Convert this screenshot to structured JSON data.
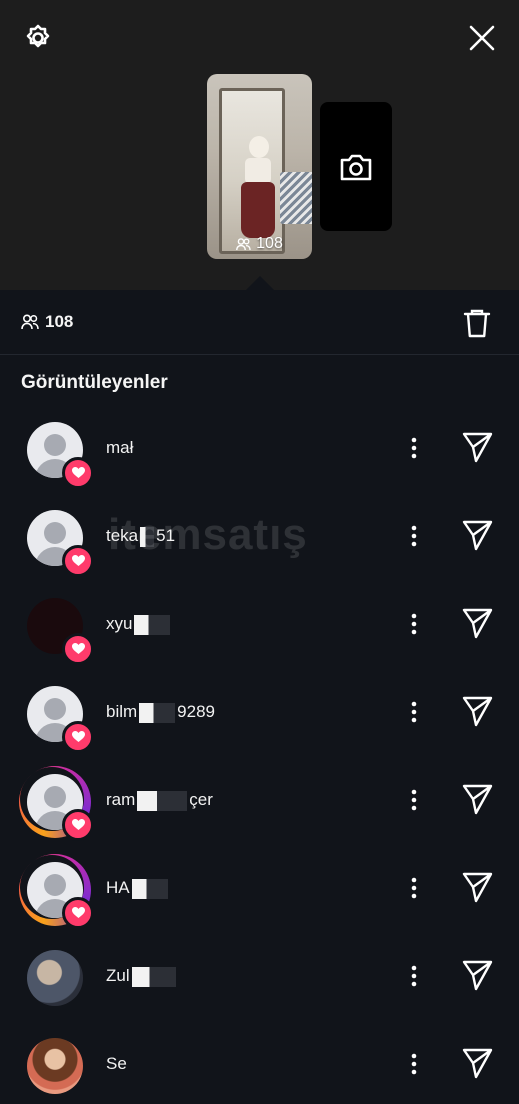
{
  "header": {
    "story_views": "108",
    "settings_icon": "gear-icon",
    "close_icon": "close-icon",
    "camera_icon": "camera-icon"
  },
  "summary": {
    "viewer_count": "108",
    "people_icon": "people-icon",
    "trash_icon": "trash-icon"
  },
  "section": {
    "title": "Görüntüleyenler"
  },
  "viewers": [
    {
      "name_start": "mał",
      "name_end": "",
      "ring": false,
      "avatar": "default"
    },
    {
      "name_start": "teka",
      "name_end": "51",
      "ring": false,
      "avatar": "default"
    },
    {
      "name_start": "xyu",
      "name_end": "",
      "ring": false,
      "avatar": "dark"
    },
    {
      "name_start": "bilm",
      "name_end": "9289",
      "ring": false,
      "avatar": "default"
    },
    {
      "name_start": "ram",
      "name_end": "çer",
      "ring": true,
      "avatar": "default"
    },
    {
      "name_start": "HA",
      "name_end": "",
      "ring": true,
      "avatar": "default"
    },
    {
      "name_start": "Zul",
      "name_end": "",
      "ring": false,
      "avatar": "photo1"
    },
    {
      "name_start": "Se",
      "name_end": "",
      "ring": false,
      "avatar": "photo2"
    }
  ],
  "watermark": {
    "text": "itemsatış"
  },
  "colors": {
    "accent_heart": "#ff3b6b",
    "background": "#11141a",
    "header_bg": "#1d1d1d"
  }
}
